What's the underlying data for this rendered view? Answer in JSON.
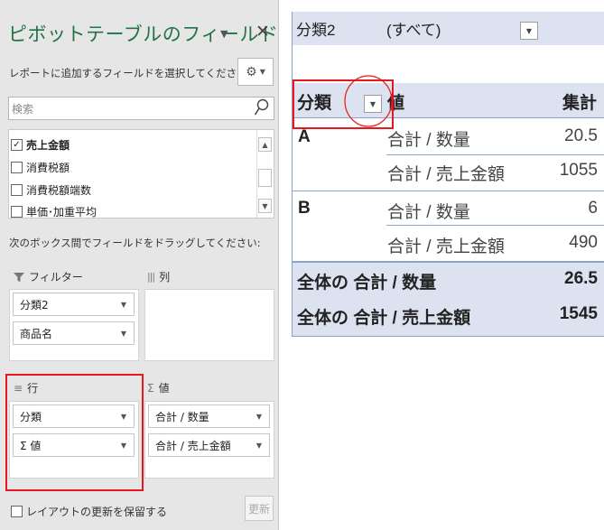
{
  "field_pane": {
    "title": "ピボットテーブルのフィールド",
    "choose_label": "レポートに追加するフィールドを選択してください:",
    "search_placeholder": "検索",
    "fields": [
      {
        "label": "売上金額",
        "checked": true
      },
      {
        "label": "消費税額",
        "checked": false
      },
      {
        "label": "消費税額端数",
        "checked": false
      },
      {
        "label": "単価･加重平均",
        "checked": false
      }
    ],
    "drag_label": "次のボックス間でフィールドをドラッグしてください:",
    "areas": {
      "filter": {
        "title": "フィルター",
        "items": [
          "分類2",
          "商品名"
        ]
      },
      "columns": {
        "title": "列",
        "items": []
      },
      "rows": {
        "title": "行",
        "items": [
          "分類",
          "Σ 値"
        ]
      },
      "values": {
        "title": "値",
        "items": [
          "合計 / 数量",
          "合計 / 売上金額"
        ]
      }
    },
    "defer_update_label": "レイアウトの更新を保留する",
    "update_button": "更新"
  },
  "pivot": {
    "filter_field": "分類2",
    "filter_value": "(すべて)",
    "header": {
      "row_label": "分類",
      "values_label": "値",
      "total_label": "集計"
    },
    "rows": [
      {
        "category": "A",
        "measure": "合計 / 数量",
        "value": "20.5"
      },
      {
        "category": "",
        "measure": "合計 / 売上金額",
        "value": "1055"
      },
      {
        "category": "B",
        "measure": "合計 / 数量",
        "value": "6"
      },
      {
        "category": "",
        "measure": "合計 / 売上金額",
        "value": "490"
      }
    ],
    "grand_totals": [
      {
        "label": "全体の 合計 / 数量",
        "value": "26.5"
      },
      {
        "label": "全体の 合計 / 売上金額",
        "value": "1545"
      }
    ]
  },
  "colors": {
    "accent_green": "#217346",
    "highlight_red": "#e8161d",
    "header_band": "#dce2ef"
  }
}
